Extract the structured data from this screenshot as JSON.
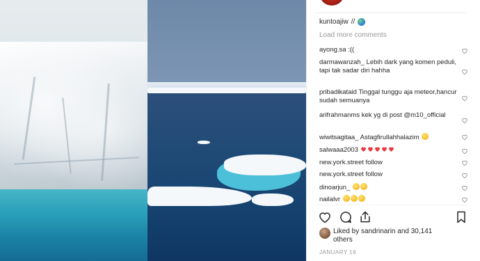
{
  "post": {
    "caption": {
      "username": "kuntoajiw",
      "text": "//"
    },
    "load_more": "Load more comments",
    "comments": [
      {
        "username": "ayong.sa",
        "text": ":(("
      },
      {
        "username": "darmawanzah_",
        "text": "Lebih dark yang komen peduli, tapi tak sadar diri hahha"
      },
      {
        "username": "pribadikataid",
        "text": "Tinggal tunggu aja meteor,hancur sudah semuanya"
      },
      {
        "username": "arifrahmanms",
        "text": "kek yg di post @m10_official"
      },
      {
        "username": "wiwitsagitaa_",
        "text": "Astagfirullahhalazim"
      },
      {
        "username": "salwaaa2003",
        "text": ""
      },
      {
        "username": "new.york.street",
        "text": "follow"
      },
      {
        "username": "new.york.street",
        "text": "follow"
      },
      {
        "username": "dinoarjun_",
        "text": ""
      },
      {
        "username": "nailalvr",
        "text": ""
      }
    ],
    "likes": "Liked by sandrinarin and 30,141 others",
    "date": "JANUARY 16"
  },
  "icons": {
    "like": "heart-outline-icon",
    "comment": "speech-bubble-icon",
    "share": "share-icon",
    "save": "bookmark-icon"
  },
  "colors": {
    "text": "#262626",
    "muted": "#999999",
    "divider": "#efefef",
    "heart_emoji": "#e8373f"
  }
}
